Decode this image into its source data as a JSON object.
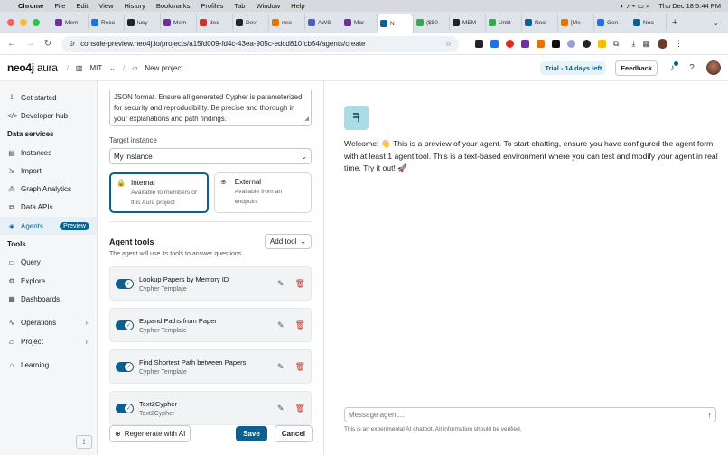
{
  "macos": {
    "app_name": "Chrome",
    "menus": [
      "File",
      "Edit",
      "View",
      "History",
      "Bookmarks",
      "Profiles",
      "Tab",
      "Window",
      "Help"
    ],
    "datetime": "Thu Dec 18  5:44 PM"
  },
  "browser": {
    "tabs": [
      {
        "label": "Mem",
        "color": "#6b2fa0"
      },
      {
        "label": "Reco",
        "color": "#1a73e8"
      },
      {
        "label": "lucy",
        "color": "#222222"
      },
      {
        "label": "Mem",
        "color": "#6b2fa0"
      },
      {
        "label": "dec",
        "color": "#d93025"
      },
      {
        "label": "Dev",
        "color": "#222222"
      },
      {
        "label": "neo",
        "color": "#e37400"
      },
      {
        "label": "AWS",
        "color": "#4a5fc1"
      },
      {
        "label": "Mar",
        "color": "#6b2fa0"
      },
      {
        "label": "N",
        "color": "#0a6190",
        "active": true
      },
      {
        "label": "($50",
        "color": "#34a853"
      },
      {
        "label": "MEM",
        "color": "#222222"
      },
      {
        "label": "Untit",
        "color": "#34a853"
      },
      {
        "label": "Neo",
        "color": "#0a6190"
      },
      {
        "label": "[Me",
        "color": "#e37400"
      },
      {
        "label": "Gen",
        "color": "#1a73e8"
      },
      {
        "label": "Neo",
        "color": "#0a6190"
      }
    ],
    "url": "console-preview.neo4j.io/projects/a15fd009-fd4c-43ea-905c-edcd810fcb54/agents/create"
  },
  "header": {
    "logo_main": "neo4j",
    "logo_sub": "aura",
    "org": "MIT",
    "project": "New project",
    "trial": "Trial - 14 days left",
    "feedback": "Feedback"
  },
  "sidebar": {
    "items_top": [
      {
        "label": "Get started",
        "icon": "rocket-icon",
        "glyph": "⟟"
      },
      {
        "label": "Developer hub",
        "icon": "code-icon",
        "glyph": "</>"
      }
    ],
    "section_data": "Data services",
    "items_data": [
      {
        "label": "Instances",
        "icon": "database-icon",
        "glyph": "▤"
      },
      {
        "label": "Import",
        "icon": "import-icon",
        "glyph": "⇲"
      },
      {
        "label": "Graph Analytics",
        "icon": "graph-icon",
        "glyph": "⁂"
      },
      {
        "label": "Data APIs",
        "icon": "api-icon",
        "glyph": "⧉"
      },
      {
        "label": "Agents",
        "icon": "agents-icon",
        "glyph": "◈",
        "badge": "Preview",
        "active": true
      }
    ],
    "section_tools": "Tools",
    "items_tools": [
      {
        "label": "Query",
        "icon": "query-icon",
        "glyph": "▭"
      },
      {
        "label": "Explore",
        "icon": "explore-icon",
        "glyph": "⚙"
      },
      {
        "label": "Dashboards",
        "icon": "dashboard-icon",
        "glyph": "▦"
      }
    ],
    "items_bottom": [
      {
        "label": "Operations",
        "icon": "operations-icon",
        "glyph": "∿",
        "chevron": true
      },
      {
        "label": "Project",
        "icon": "folder-icon",
        "glyph": "▱",
        "chevron": true
      }
    ],
    "learning": "Learning"
  },
  "form": {
    "instructions_text": "JSON format. Ensure all generated Cypher is parameterized for security and reproducibility. Be precise and thorough in your explanations and path findings.",
    "target_label": "Target instance",
    "target_value": "My instance",
    "access": [
      {
        "title": "Internal",
        "subtitle": "Available to members of this Aura project",
        "icon": "lock-icon",
        "glyph": "🔒",
        "selected": true
      },
      {
        "title": "External",
        "subtitle": "Available from an endpoint",
        "icon": "globe-icon",
        "glyph": "⊕",
        "selected": false
      }
    ],
    "tools_title": "Agent tools",
    "tools_subtitle": "The agent will use its tools to answer questions",
    "add_tool": "Add tool",
    "tools": [
      {
        "name": "Lookup Papers by Memory ID",
        "type": "Cypher Template"
      },
      {
        "name": "Expand Paths from Paper",
        "type": "Cypher Template"
      },
      {
        "name": "Find Shortest Path between Papers",
        "type": "Cypher Template"
      },
      {
        "name": "Text2Cypher",
        "type": "Text2Cypher"
      }
    ],
    "regenerate": "Regenerate with AI",
    "save": "Save",
    "cancel": "Cancel"
  },
  "chat": {
    "welcome": "Welcome! 👋 This is a preview of your agent. To start chatting, ensure you have configured the agent form with at least 1 agent tool. This is a text-based environment where you can test and modify your agent in real time. Try it out! 🚀",
    "placeholder": "Message agent...",
    "disclaimer": "This is an experimental AI chatbot. All information should be verified."
  }
}
